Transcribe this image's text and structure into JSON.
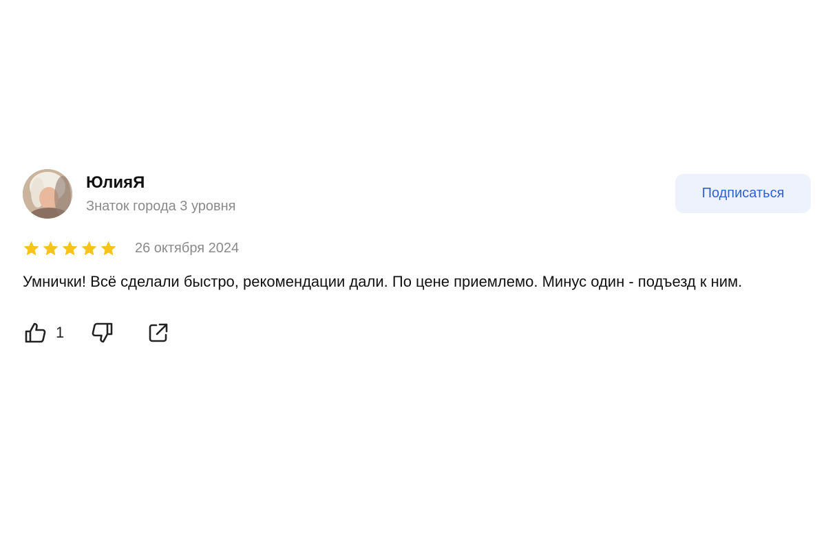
{
  "review": {
    "author": {
      "name": "ЮлияЯ",
      "level": "Знаток города 3 уровня",
      "avatar": "user-photo"
    },
    "subscribe_label": "Подписаться",
    "rating": {
      "value": 5,
      "max": 5
    },
    "date": "26 октября 2024",
    "text": "Умнички! Всё сделали быстро, рекомендации дали. По цене приемлемо. Минус один - подъезд к ним.",
    "actions": {
      "like_icon": "thumb-up-icon",
      "like_count": "1",
      "dislike_icon": "thumb-down-icon",
      "share_icon": "share-icon"
    }
  },
  "colors": {
    "star": "#f7c21a",
    "subscribe_text": "#2f5fd6",
    "subscribe_bg": "#eef2fc",
    "muted_text": "#8a8a8a"
  }
}
